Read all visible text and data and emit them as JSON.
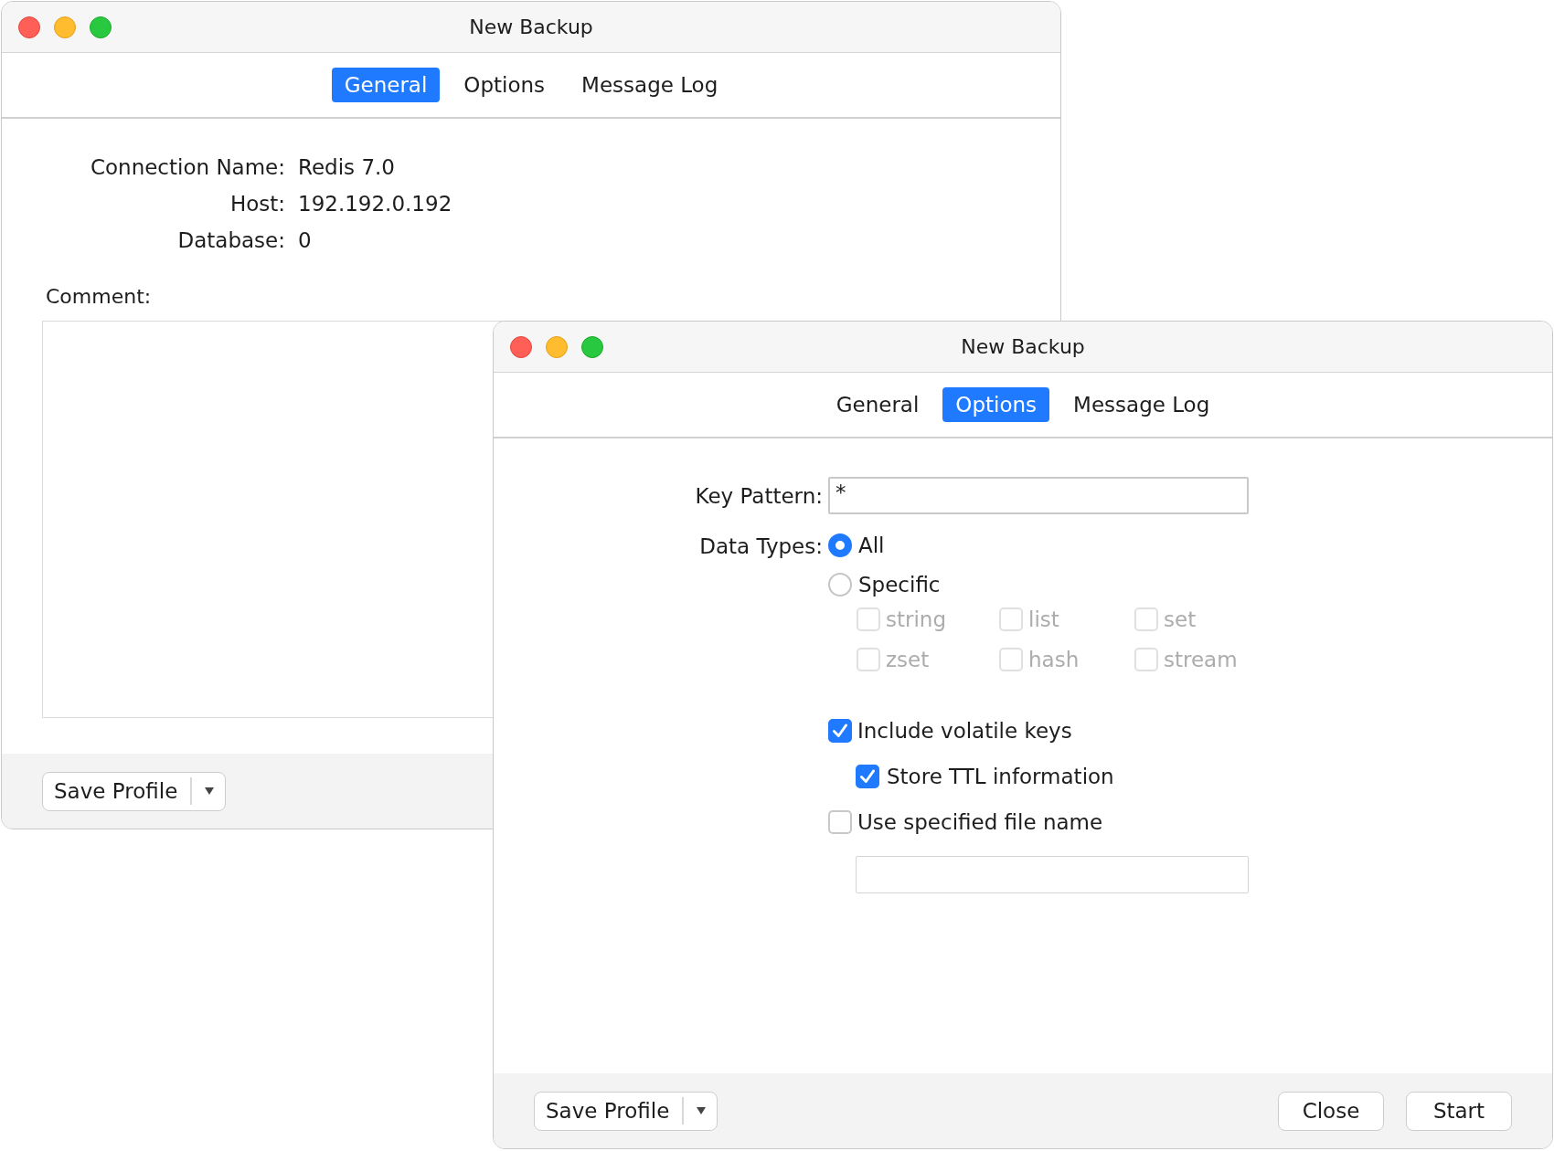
{
  "windows": [
    {
      "title": "New Backup",
      "tabs": [
        {
          "label": "General",
          "selected": true
        },
        {
          "label": "Options",
          "selected": false
        },
        {
          "label": "Message Log",
          "selected": false
        }
      ],
      "content": {
        "kind": "general",
        "fields": [
          {
            "label": "Connection Name:",
            "value": "Redis 7.0"
          },
          {
            "label": "Host:",
            "value": "192.192.0.192"
          },
          {
            "label": "Database:",
            "value": "0"
          }
        ],
        "comment_label": "Comment:"
      },
      "footer": {
        "save_profile": "Save Profile"
      }
    },
    {
      "title": "New Backup",
      "tabs": [
        {
          "label": "General",
          "selected": false
        },
        {
          "label": "Options",
          "selected": true
        },
        {
          "label": "Message Log",
          "selected": false
        }
      ],
      "content": {
        "kind": "options",
        "key_pattern": {
          "label": "Key Pattern:",
          "value": "*"
        },
        "data_types": {
          "label": "Data Types:",
          "options": [
            {
              "label": "All",
              "selected": true
            },
            {
              "label": "Specific",
              "selected": false
            }
          ],
          "types": [
            {
              "label": "string",
              "checked": false,
              "disabled": true
            },
            {
              "label": "list",
              "checked": false,
              "disabled": true
            },
            {
              "label": "set",
              "checked": false,
              "disabled": true
            },
            {
              "label": "zset",
              "checked": false,
              "disabled": true
            },
            {
              "label": "hash",
              "checked": false,
              "disabled": true
            },
            {
              "label": "stream",
              "checked": false,
              "disabled": true
            }
          ]
        },
        "checks": [
          {
            "label": "Include volatile keys",
            "checked": true,
            "children": [
              {
                "label": "Store TTL information",
                "checked": true
              }
            ]
          },
          {
            "label": "Use specified file name",
            "checked": false
          }
        ]
      },
      "footer": {
        "save_profile": "Save Profile",
        "buttons": [
          "Close",
          "Start"
        ]
      }
    }
  ]
}
